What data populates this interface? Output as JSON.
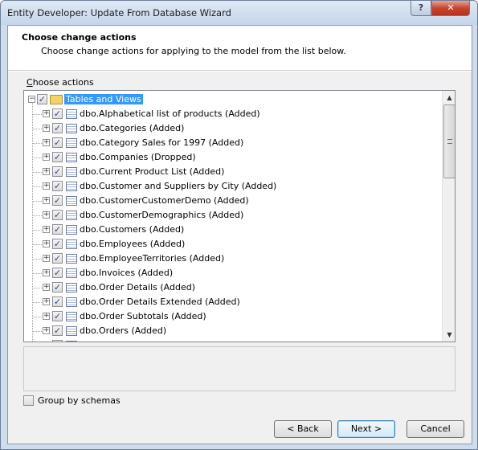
{
  "window": {
    "title": "Entity Developer: Update From Database Wizard",
    "help_label": "?",
    "close_label": "✕"
  },
  "header": {
    "title": "Choose change actions",
    "subtitle": "Choose change actions for applying to the model from the list below."
  },
  "tree": {
    "group_label_accel": "C",
    "group_label_rest": "hoose actions",
    "root": {
      "label": "Tables and Views",
      "checked": true,
      "expanded": true
    },
    "items": [
      {
        "label": "dbo.Alphabetical list of products (Added)",
        "checked": true
      },
      {
        "label": "dbo.Categories (Added)",
        "checked": true
      },
      {
        "label": "dbo.Category Sales for 1997 (Added)",
        "checked": true
      },
      {
        "label": "dbo.Companies (Dropped)",
        "checked": true
      },
      {
        "label": "dbo.Current Product List (Added)",
        "checked": true
      },
      {
        "label": "dbo.Customer and Suppliers by City (Added)",
        "checked": true
      },
      {
        "label": "dbo.CustomerCustomerDemo (Added)",
        "checked": true
      },
      {
        "label": "dbo.CustomerDemographics (Added)",
        "checked": true
      },
      {
        "label": "dbo.Customers (Added)",
        "checked": true
      },
      {
        "label": "dbo.Employees (Added)",
        "checked": true
      },
      {
        "label": "dbo.EmployeeTerritories (Added)",
        "checked": true
      },
      {
        "label": "dbo.Invoices (Added)",
        "checked": true
      },
      {
        "label": "dbo.Order Details (Added)",
        "checked": true
      },
      {
        "label": "dbo.Order Details Extended (Added)",
        "checked": true
      },
      {
        "label": "dbo.Order Subtotals (Added)",
        "checked": true
      },
      {
        "label": "dbo.Orders (Added)",
        "checked": true
      },
      {
        "label": "dbo.Orders Qry (Added)",
        "checked": true
      }
    ],
    "scroll_position": 0
  },
  "options": {
    "group_by_schemas_label": "Group by schemas",
    "group_by_schemas_checked": false
  },
  "buttons": {
    "back": "< Back",
    "next": "Next >",
    "cancel": "Cancel"
  }
}
